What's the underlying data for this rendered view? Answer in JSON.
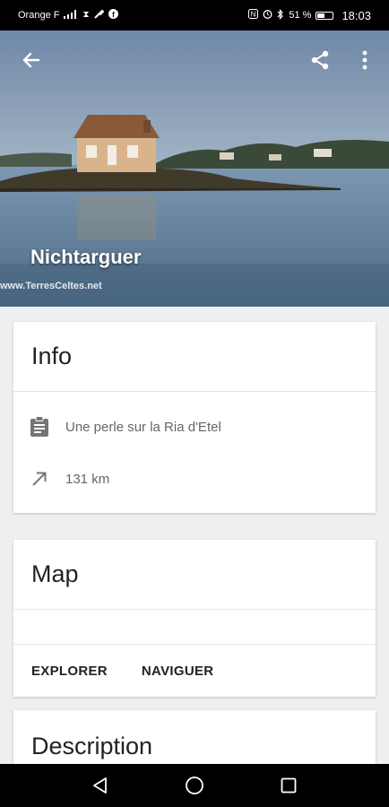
{
  "status_bar": {
    "carrier": "Orange F",
    "battery": "51 %",
    "time": "18:03",
    "icons": [
      "signal-icon",
      "hourglass-icon",
      "wrench-icon",
      "facebook-icon",
      "nfc-icon",
      "alarm-icon",
      "bluetooth-icon",
      "battery-icon"
    ]
  },
  "hero": {
    "title": "Nichtarguer",
    "watermark": "www.TerresCeltes.net",
    "icons": [
      "back-arrow-icon",
      "share-icon",
      "more-vert-icon"
    ]
  },
  "info_card": {
    "title": "Info",
    "rows": [
      {
        "icon": "clipboard-icon",
        "text": "Une perle sur la Ria d'Etel"
      },
      {
        "icon": "arrow-northeast-icon",
        "text": "131 km"
      }
    ]
  },
  "map_card": {
    "title": "Map",
    "actions": [
      "EXPLORER",
      "NAVIGUER"
    ]
  },
  "description_card": {
    "title": "Description"
  },
  "colors": {
    "status_bar": "#000000",
    "background": "#efefef",
    "card": "#ffffff",
    "water": "#5f7f9e",
    "sky": "#8aa3bd"
  }
}
